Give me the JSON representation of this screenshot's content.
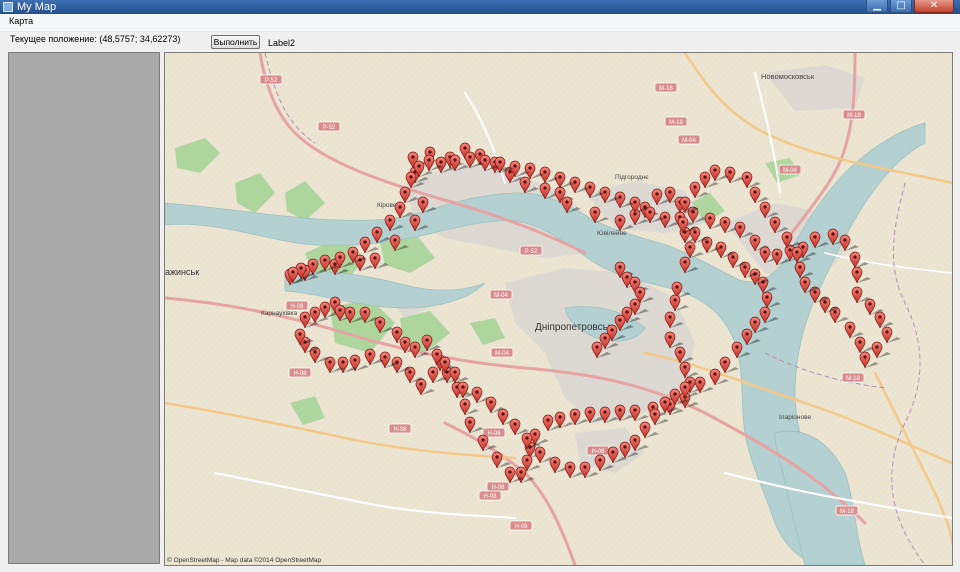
{
  "window": {
    "title": "My Map",
    "controls": {
      "minimize": "▁",
      "maximize": "□",
      "close": "✕"
    }
  },
  "menu": {
    "items": [
      "Карта"
    ]
  },
  "toolbar": {
    "status_label": "Текущее положение: (48,5757; 34,62273)",
    "run_button_label": "Выполнить",
    "label2": "Label2"
  },
  "map": {
    "place_labels": [
      "Новомосковськ",
      "Підгороднє",
      "Кірове",
      "Юв",
      "ажинськ",
      "Карнаухівка",
      "Дніпропетровськ",
      "Ювілейне",
      "Іларіонове"
    ],
    "road_shields": [
      "Р-52",
      "Р-52",
      "Р-52",
      "М-18",
      "М-18",
      "М-18",
      "М-18",
      "М-04",
      "М-04",
      "М-04",
      "М-04",
      "Н-08",
      "Н-08",
      "Н-08",
      "Н-08",
      "Н-08",
      "Н-08",
      "Н-08",
      "Н-08",
      "М-18"
    ],
    "attribution": "© OpenStreetMap - Map data ©2014 OpenStreetMap",
    "colors": {
      "land": "#ebe5d5",
      "water": "#b5d0d0",
      "park": "#a9d49a",
      "urban": "#ddd9d3",
      "marker": "#e83b32",
      "road_shield": "#d98d8d"
    },
    "marker_icon": "map-pin-icon",
    "marker_count": 210
  }
}
